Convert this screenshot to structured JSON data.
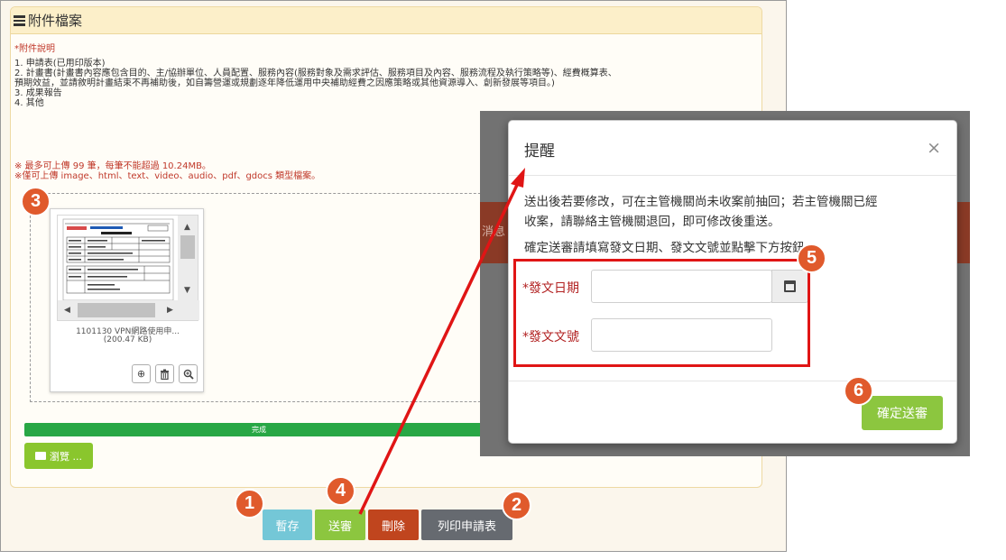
{
  "panel": {
    "title": "附件檔案"
  },
  "notes": {
    "heading": "*附件說明",
    "lines": [
      "1. 申請表(已用印版本)",
      "2. 計畫書(計畫書內容應包含目的、主/協辦單位、人員配置、服務內容(服務對象及需求評估、服務項目及內容、服務流程及執行策略等)、經費概算表、",
      "預期效益，並請敘明計畫結束不再補助後，如自籌營運或規劃逐年降低運用中央補助經費之因應策略或其他資源導入、創新發展等項目。)",
      "3. 成果報告",
      "4. 其他"
    ],
    "warn_1": "※ 最多可上傳 99 筆，每筆不能超過 10.24MB。",
    "warn_2": "※僅可上傳 image、html、text、video、audio、pdf、gdocs 類型檔案。"
  },
  "file": {
    "name": "1101130 VPN網路使用申...",
    "size": "(200.47 KB)",
    "icons": [
      "download-icon",
      "trash-icon",
      "zoom-icon"
    ]
  },
  "upload": {
    "progress_label": "完成",
    "progress_fraction": 1.0,
    "browse_label": "瀏覽 ..."
  },
  "actions": {
    "save": "暫存",
    "submit": "送審",
    "delete": "刪除",
    "print": "列印申請表"
  },
  "overlay_fragment": "消息",
  "modal": {
    "title": "提醒",
    "close": "×",
    "line_1": "送出後若要修改，可在主管機關尚未收案前抽回；若主管機關已經",
    "line_2": "收案，請聯絡主管機關退回，即可修改後重送。",
    "line_3": "確定送審請填寫發文日期、發文文號並點擊下方按鈕",
    "date_label": "*發文日期",
    "date_value": "",
    "number_label": "*發文文號",
    "number_value": "",
    "confirm": "確定送審"
  },
  "badges": [
    "1",
    "2",
    "3",
    "4",
    "5",
    "6"
  ],
  "colors": {
    "accent_green": "#8cc63f",
    "danger": "#c0451e",
    "info": "#74c7d7",
    "annotation_red": "#e01515",
    "badge_orange": "#e05a2c"
  }
}
